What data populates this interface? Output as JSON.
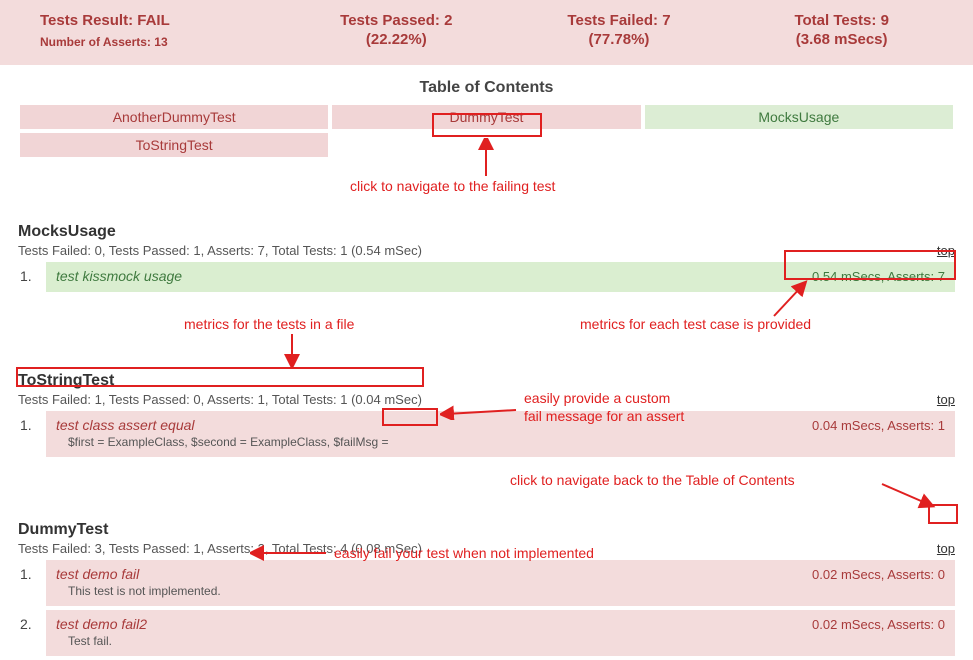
{
  "header": {
    "result_label": "Tests Result:",
    "result_value": "FAIL",
    "asserts_label": "Number of Asserts:",
    "asserts_value": "13",
    "passed_label": "Tests Passed:",
    "passed_value": "2",
    "passed_pct": "(22.22%)",
    "failed_label": "Tests Failed:",
    "failed_value": "7",
    "failed_pct": "(77.78%)",
    "total_label": "Total Tests:",
    "total_value": "9",
    "total_time": "(3.68 mSecs)"
  },
  "toc": {
    "heading": "Table of Contents",
    "items": [
      {
        "label": "AnotherDummyTest",
        "status": "fail"
      },
      {
        "label": "DummyTest",
        "status": "fail"
      },
      {
        "label": "MocksUsage",
        "status": "pass"
      },
      {
        "label": "ToStringTest",
        "status": "fail"
      }
    ]
  },
  "top_link": "top",
  "sections": [
    {
      "title": "MocksUsage",
      "meta": "Tests Failed: 0, Tests Passed: 1, Asserts: 7, Total Tests: 1 (0.54 mSec)",
      "rows": [
        {
          "num": "1.",
          "name": "test kissmock usage",
          "metrics": "0.54 mSecs, Asserts: 7",
          "status": "pass",
          "detail": ""
        }
      ]
    },
    {
      "title": "ToStringTest",
      "meta": "Tests Failed: 1, Tests Passed: 0, Asserts: 1, Total Tests: 1 (0.04 mSec)",
      "rows": [
        {
          "num": "1.",
          "name": "test class assert equal",
          "metrics": "0.04 mSecs, Asserts: 1",
          "status": "fail",
          "detail": "$first = ExampleClass, $second = ExampleClass, $failMsg ="
        }
      ]
    },
    {
      "title": "DummyTest",
      "meta": "Tests Failed: 3, Tests Passed: 1, Asserts: 2, Total Tests: 4 (0.08 mSec)",
      "rows": [
        {
          "num": "1.",
          "name": "test demo fail",
          "metrics": "0.02 mSecs, Asserts: 0",
          "status": "fail",
          "detail": "This test is not implemented."
        },
        {
          "num": "2.",
          "name": "test demo fail2",
          "metrics": "0.02 mSecs, Asserts: 0",
          "status": "fail",
          "detail": "Test fail."
        }
      ]
    }
  ],
  "annotations": {
    "a1": "click to navigate to the failing test",
    "a2": "metrics for the tests in a file",
    "a3": "metrics for each test case is provided",
    "a4": "easily provide a custom",
    "a4b": "fail message for an assert",
    "a5": "click to navigate back to the Table of Contents",
    "a6": "easily fail your test when not implemented"
  }
}
